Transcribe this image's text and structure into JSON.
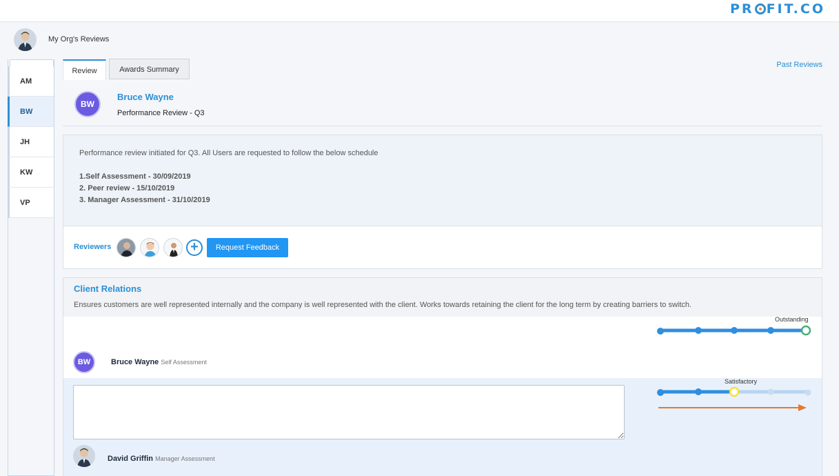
{
  "brand": {
    "logo_left": "PR",
    "logo_right": "FIT.CO",
    "color": "#2a8fd6"
  },
  "header": {
    "title": "My Org's Reviews"
  },
  "sidebar": {
    "items": [
      {
        "label": "AM",
        "active": false
      },
      {
        "label": "BW",
        "active": true
      },
      {
        "label": "JH",
        "active": false
      },
      {
        "label": "KW",
        "active": false
      },
      {
        "label": "VP",
        "active": false
      }
    ]
  },
  "tabs": {
    "review": "Review",
    "awards": "Awards Summary",
    "past_reviews": "Past Reviews"
  },
  "employee": {
    "initials": "BW",
    "name": "Bruce Wayne",
    "review_title": "Performance Review - Q3"
  },
  "schedule": {
    "intro": "Performance review initiated for Q3. All Users are requested to follow the below schedule",
    "steps": [
      "1.Self Assessment - 30/09/2019",
      "2. Peer review - 15/10/2019",
      "3. Manager Assessment - 31/10/2019"
    ]
  },
  "reviewers": {
    "label": "Reviewers",
    "add_icon": "+",
    "request_button": "Request Feedback"
  },
  "kpi": {
    "title": "Client Relations",
    "description": "Ensures customers are well represented internally and the company is well represented with the client. Works towards retaining the client for the long term by creating barriers to switch."
  },
  "self_assessment": {
    "initials": "BW",
    "name": "Bruce Wayne",
    "role": "Self Assessment",
    "rating_label": "Outstanding",
    "rating_level": 5,
    "rating_max": 5
  },
  "manager_assessment": {
    "name": "David Griffin",
    "role": "Manager Assessment",
    "rating_label": "Satisfactory",
    "rating_level": 3,
    "rating_max": 5,
    "comment": ""
  },
  "colors": {
    "accent": "#2a8fd6",
    "button": "#2196f3",
    "avatar": "#6a5be0",
    "outstanding": "#4caf7a",
    "satisfactory": "#f5e23a",
    "arrow": "#e8772e"
  }
}
